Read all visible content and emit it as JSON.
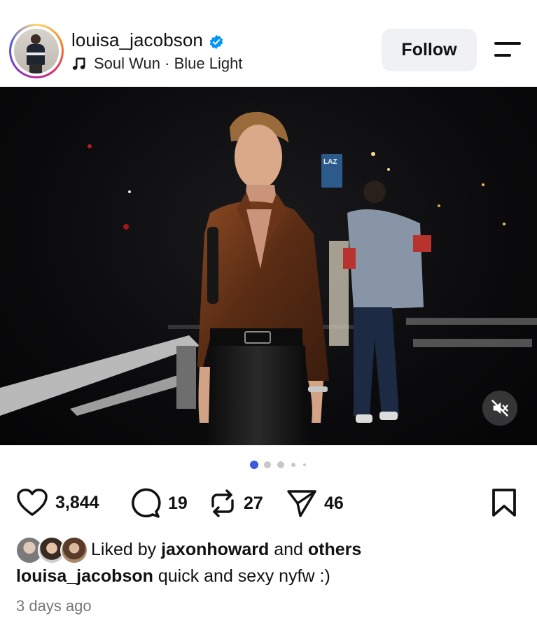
{
  "post": {
    "username": "louisa_jacobson",
    "verified": true,
    "music": {
      "song": "Soul Wun",
      "separator": "·",
      "artist": "Blue Light"
    },
    "follow_label": "Follow",
    "media": {
      "sign_text": "LAZ",
      "carousel_count": 5,
      "carousel_active_index": 0,
      "muted": true
    },
    "actions": {
      "likes": "3,844",
      "comments": "19",
      "reposts": "27",
      "shares": "46"
    },
    "liked_by": {
      "prefix": "Liked by",
      "user": "jaxonhoward",
      "connector": "and",
      "others": "others"
    },
    "caption": {
      "username": "louisa_jacobson",
      "text": "quick and sexy nyfw :)"
    },
    "timestamp": "3 days ago"
  },
  "icons": {
    "verified": "verified-badge-icon",
    "music": "music-note-icon",
    "menu": "menu-icon",
    "mute": "speaker-muted-icon",
    "like": "heart-icon",
    "comment": "comment-icon",
    "repost": "repost-icon",
    "share": "send-icon",
    "save": "bookmark-icon"
  },
  "colors": {
    "verified_blue": "#0095f6",
    "carousel_active": "#3b5bdb",
    "carousel_inactive": "#c7c7c7",
    "follow_bg": "#eff1f4",
    "timestamp_gray": "#777777"
  }
}
